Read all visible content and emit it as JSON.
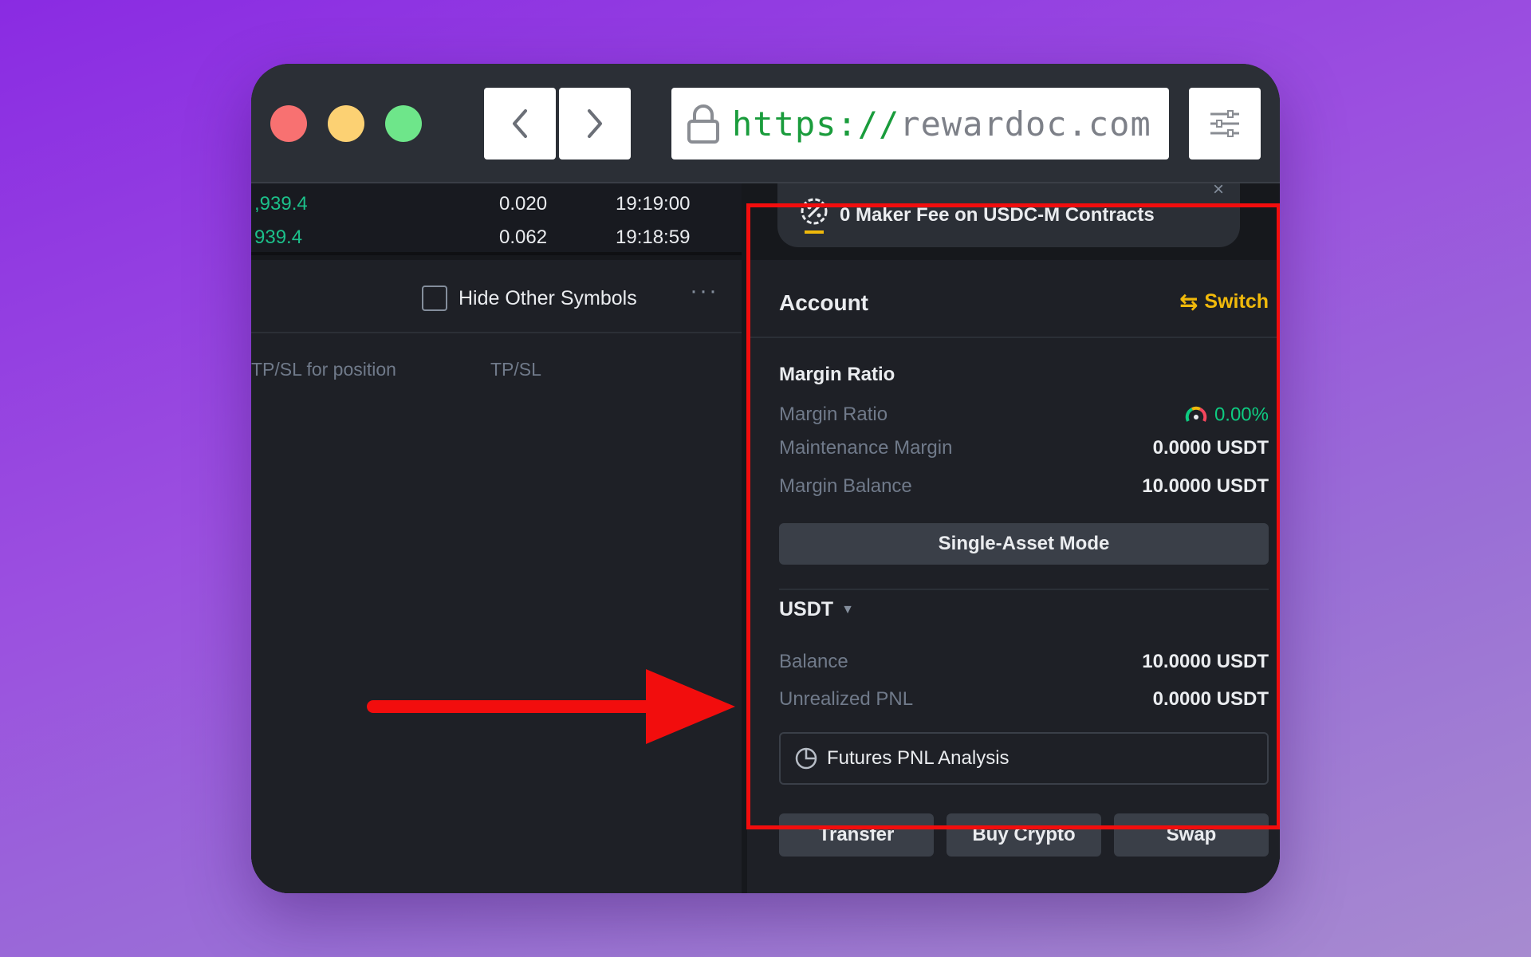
{
  "browser": {
    "url_scheme": "https://",
    "url_host": "rewardoc.com"
  },
  "trades": [
    {
      "price": ",939.4",
      "qty": "0.020",
      "time": "19:19:00"
    },
    {
      "price": "939.4",
      "qty": "0.062",
      "time": "19:18:59"
    }
  ],
  "orders_panel": {
    "hide_other_symbols": "Hide Other Symbols",
    "more": "···",
    "col_tpsl_position": "TP/SL for position",
    "col_tpsl": "TP/SL"
  },
  "promo": {
    "text": "0 Maker Fee on USDC-M Contracts",
    "close": "×"
  },
  "account": {
    "title": "Account",
    "switch_label": "Switch",
    "margin_section": "Margin Ratio",
    "margin_ratio_label": "Margin Ratio",
    "margin_ratio_value": "0.00%",
    "maintenance_label": "Maintenance Margin",
    "maintenance_value": "0.0000 USDT",
    "margin_balance_label": "Margin Balance",
    "margin_balance_value": "10.0000 USDT",
    "mode_button": "Single-Asset Mode",
    "asset": "USDT",
    "balance_label": "Balance",
    "balance_value": "10.0000 USDT",
    "upnl_label": "Unrealized PNL",
    "upnl_value": "0.0000 USDT",
    "pnl_analysis": "Futures PNL Analysis",
    "transfer": "Transfer",
    "buy_crypto": "Buy Crypto",
    "swap": "Swap"
  },
  "colors": {
    "accent_yellow": "#f0b90b",
    "positive_green": "#0ecb81",
    "highlight_red": "#f20d0d"
  }
}
